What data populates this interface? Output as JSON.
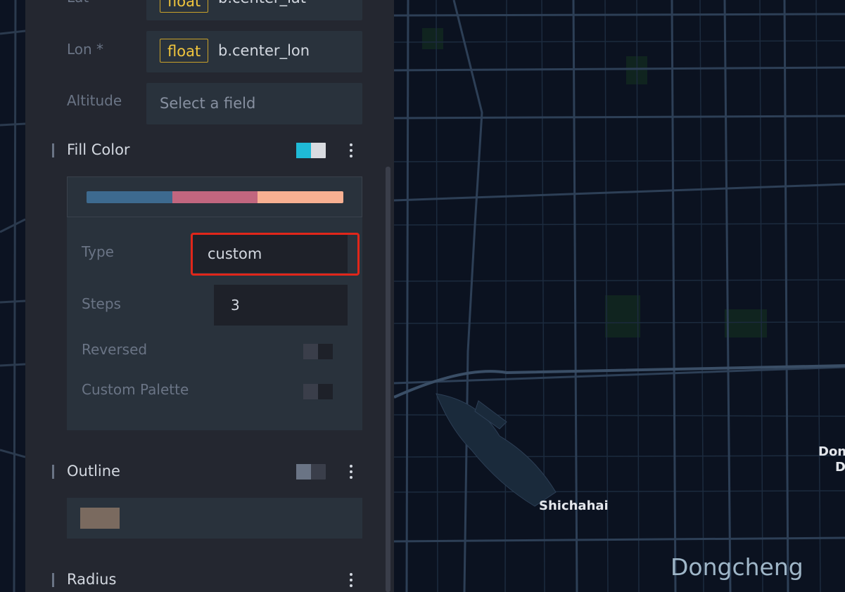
{
  "panel": {
    "fields": [
      {
        "label": "Lat",
        "type": "float",
        "value": "b.center_lat"
      },
      {
        "label": "Lon *",
        "type": "float",
        "value": "b.center_lon"
      },
      {
        "label": "Altitude",
        "placeholder": "Select a field"
      }
    ],
    "fill_color": {
      "title": "Fill Color",
      "palette_colors": [
        "#3d6a8f",
        "#c1667f",
        "#f8b092"
      ],
      "config": {
        "type_label": "Type",
        "type_value": "custom",
        "steps_label": "Steps",
        "steps_value": "3",
        "reversed_label": "Reversed",
        "custom_palette_label": "Custom Palette"
      }
    },
    "outline": {
      "title": "Outline",
      "swatch_color": "#7a6a5f"
    },
    "radius": {
      "title": "Radius"
    }
  },
  "map": {
    "labels": [
      "Shichahai",
      "Dongcheng",
      "Don",
      "D"
    ]
  },
  "colors": {
    "accent_toggle": "#1fbad6",
    "highlight_box": "#e0261a",
    "type_pill": "#f0c53d"
  }
}
